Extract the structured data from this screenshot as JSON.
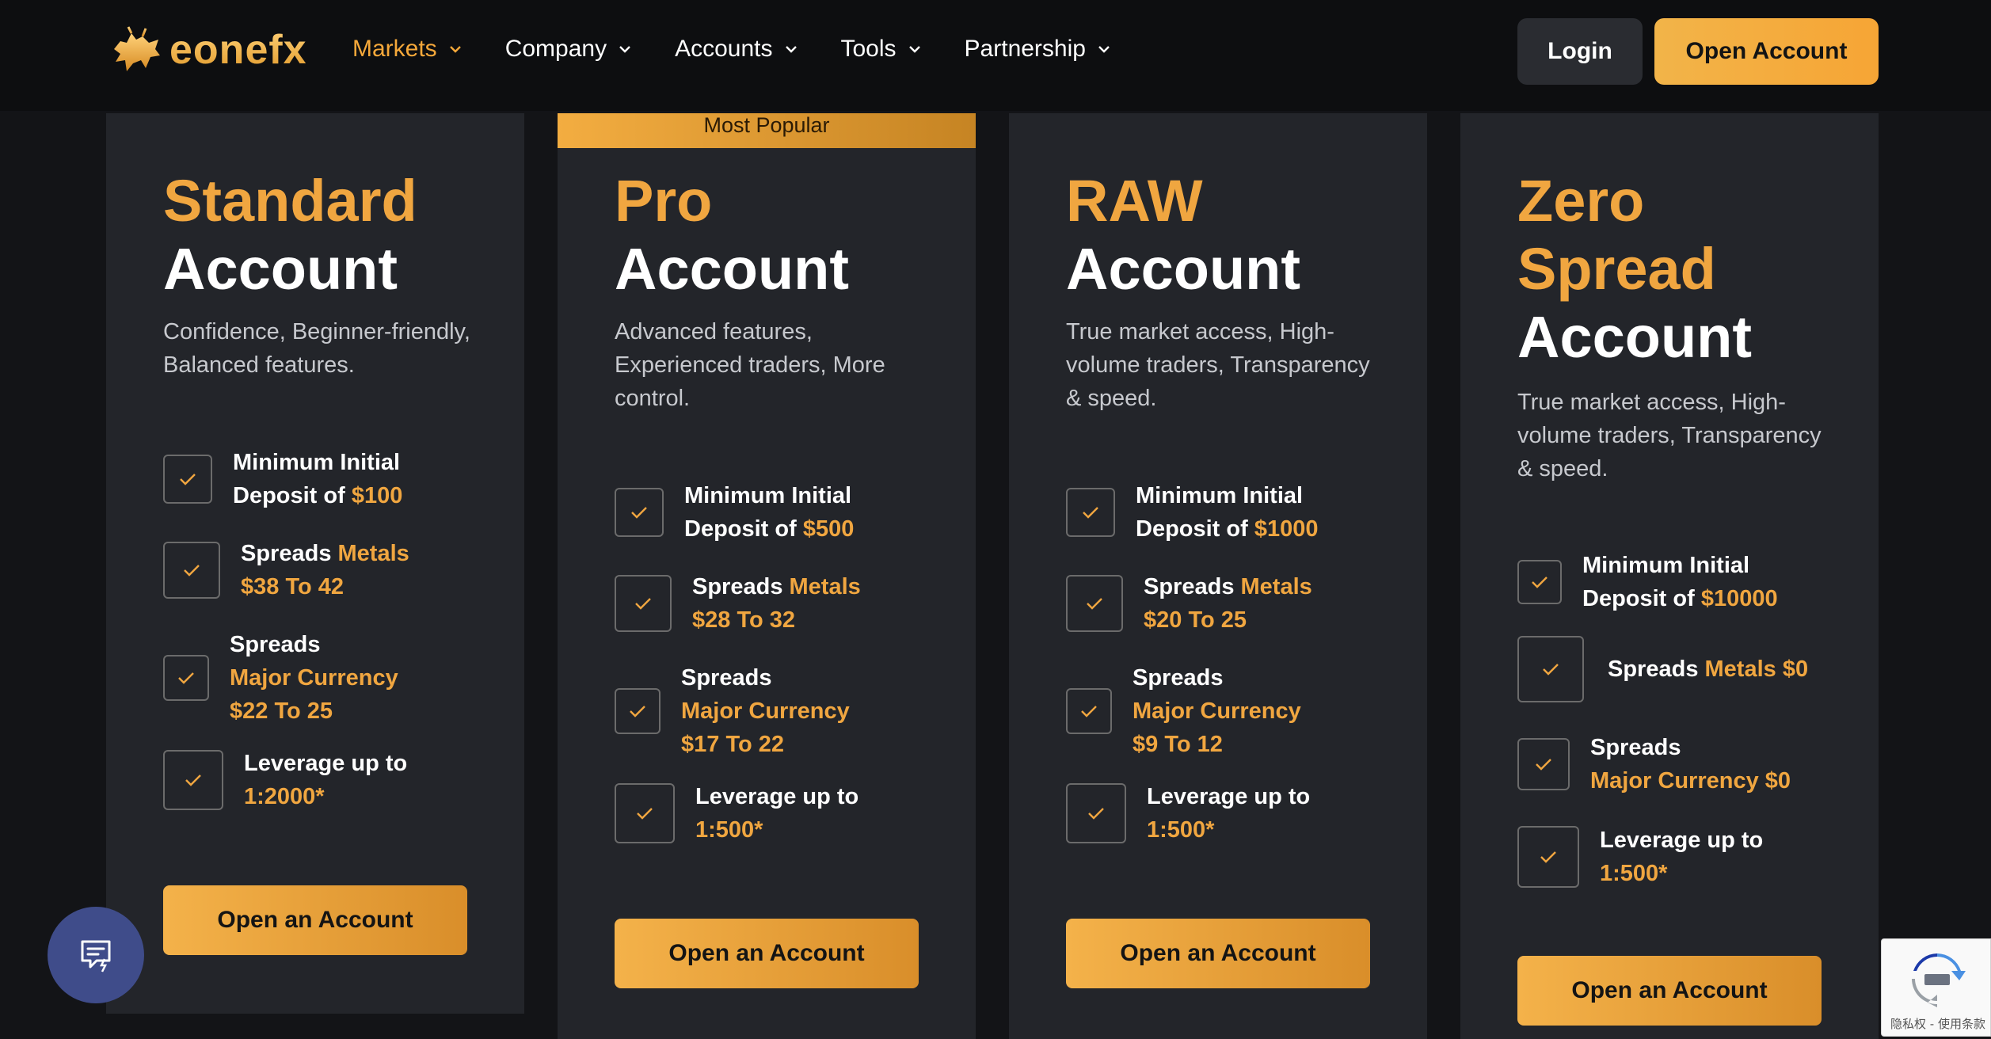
{
  "header": {
    "logo_text": "eonefx",
    "nav": [
      {
        "label": "Markets",
        "active": true
      },
      {
        "label": "Company",
        "active": false
      },
      {
        "label": "Accounts",
        "active": false
      },
      {
        "label": "Tools",
        "active": false
      },
      {
        "label": "Partnership",
        "active": false
      }
    ],
    "login_label": "Login",
    "open_account_label": "Open Account"
  },
  "colors": {
    "accent": "#f0a640",
    "background": "#131417",
    "card": "#23252a"
  },
  "cards": [
    {
      "title_accent": "Standard",
      "title_lines": [
        "Account"
      ],
      "description": "Confidence, Beginner-friendly, Balanced features.",
      "features": [
        {
          "line1": "Minimum Initial",
          "line2_prefix": "Deposit of ",
          "line2_value": "$100"
        },
        {
          "line1_prefix": "Spreads ",
          "line1_gold": "Metals",
          "line2_value": "$38 To 42"
        },
        {
          "line1": "Spreads",
          "line2_gold": "Major Currency",
          "line3_value": "$22 To 25"
        },
        {
          "line1": "Leverage up to",
          "line2_value": "1:2000*"
        }
      ],
      "button_label": "Open an Account"
    },
    {
      "badge": "Most Popular",
      "title_accent": "Pro",
      "title_lines": [
        "Account"
      ],
      "description": "Advanced features, Experienced traders, More control.",
      "features": [
        {
          "line1": "Minimum Initial",
          "line2_prefix": "Deposit of ",
          "line2_value": "$500"
        },
        {
          "line1_prefix": "Spreads ",
          "line1_gold": "Metals",
          "line2_value": "$28 To 32"
        },
        {
          "line1": "Spreads",
          "line2_gold": "Major Currency",
          "line3_value": "$17 To 22"
        },
        {
          "line1": "Leverage up to",
          "line2_value": "1:500*"
        }
      ],
      "button_label": "Open an Account"
    },
    {
      "title_accent": "RAW",
      "title_lines": [
        "Account"
      ],
      "description": "True market access, High-volume traders, Transparency & speed.",
      "features": [
        {
          "line1": "Minimum Initial",
          "line2_prefix": "Deposit of ",
          "line2_value": "$1000"
        },
        {
          "line1_prefix": "Spreads ",
          "line1_gold": "Metals",
          "line2_value": "$20 To 25"
        },
        {
          "line1": "Spreads",
          "line2_gold": "Major Currency",
          "line3_value": "$9 To 12"
        },
        {
          "line1": "Leverage up to",
          "line2_value": "1:500*"
        }
      ],
      "button_label": "Open an Account"
    },
    {
      "title_accent": "Zero",
      "title_accent2": "Spread",
      "title_lines": [
        "Account"
      ],
      "description": "True market access, High-volume traders, Transparency & speed.",
      "features": [
        {
          "line1": "Minimum Initial",
          "line2_prefix": "Deposit of ",
          "line2_value": "$10000"
        },
        {
          "line1_prefix": "Spreads ",
          "line1_gold": "Metals $0"
        },
        {
          "line1": "Spreads",
          "line2_gold": "Major Currency $0"
        },
        {
          "line1": "Leverage up to",
          "line2_value": "1:500*"
        }
      ],
      "button_label": "Open an Account"
    }
  ],
  "widgets": {
    "chat_icon": "chat-icon",
    "recaptcha_text": "隐私权 - 使用条款"
  }
}
